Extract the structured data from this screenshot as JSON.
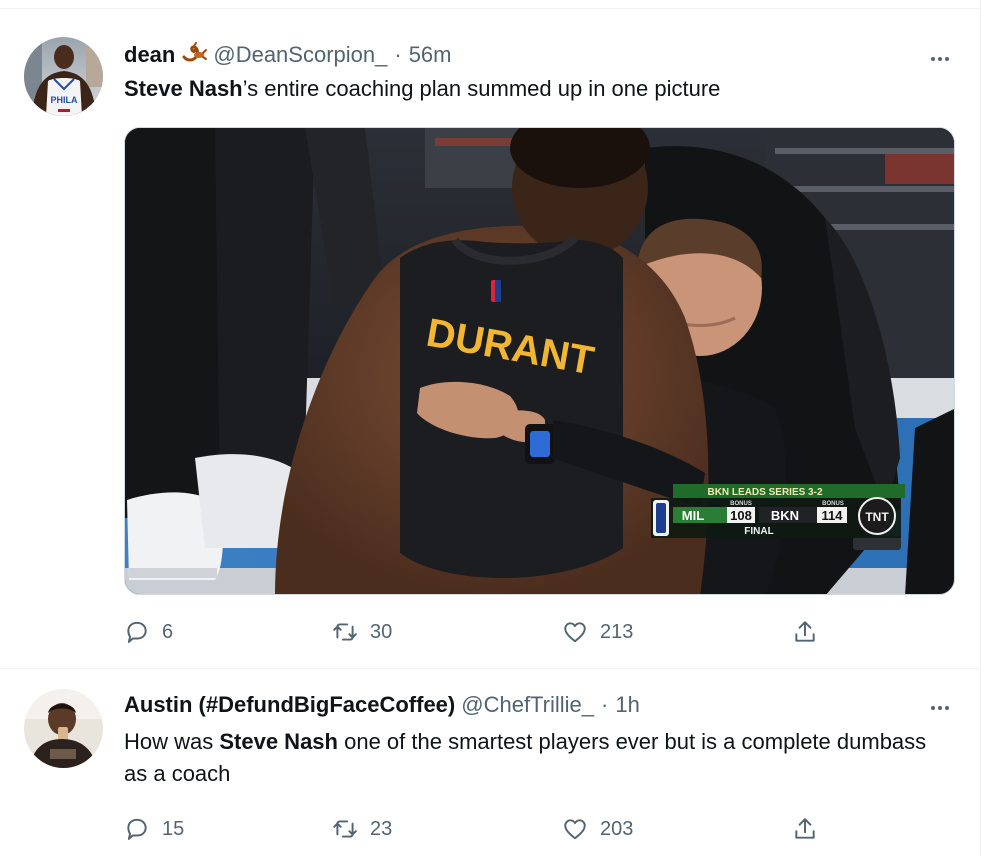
{
  "tweets": [
    {
      "author_name": "dean",
      "author_emoji": "scorpion-emoji",
      "handle": "@DeanScorpion_",
      "separator": "·",
      "time": "56m",
      "text_bold": "Steve Nash",
      "text_rest": "’s entire coaching plan summed up in one picture",
      "avatar_jersey_text": "PHILA",
      "media": {
        "jersey_name": "DURANT",
        "scorebug": {
          "headline": "BKN LEADS SERIES 3-2",
          "bonus_left": "BONUS",
          "bonus_right": "BONUS",
          "team1": "MIL",
          "score1": "108",
          "team2": "BKN",
          "score2": "114",
          "status": "FINAL",
          "network": "TNT"
        }
      },
      "replies": "6",
      "retweets": "30",
      "likes": "213"
    },
    {
      "author_name": "Austin (#DefundBigFaceCoffee)",
      "handle": "@ChefTrillie_",
      "separator": "·",
      "time": "1h",
      "text_pre": "How was ",
      "text_bold": "Steve Nash",
      "text_rest": " one of the smartest players ever but is a complete dumbass as a coach",
      "replies": "15",
      "retweets": "23",
      "likes": "203"
    }
  ],
  "icons": {
    "reply": "reply-icon",
    "retweet": "retweet-icon",
    "like": "heart-icon",
    "share": "share-icon",
    "more": "more-icon"
  },
  "colors": {
    "text_primary": "#0f1419",
    "text_secondary": "#536471",
    "divider": "#eff3f4",
    "court_blue": "#2d6fb5",
    "jersey_gold": "#f2b632",
    "score_green": "#1f6b2a"
  }
}
